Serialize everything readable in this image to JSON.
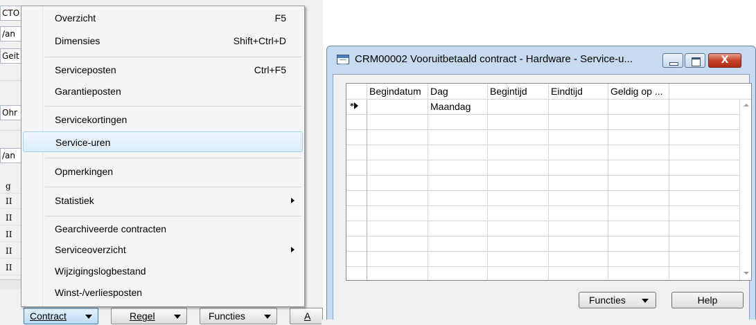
{
  "background": {
    "fields": [
      "CTO",
      "/an",
      "Geit",
      "Ohr",
      "/an",
      "g"
    ],
    "row_labels": [
      "II",
      "II",
      "II",
      "II",
      "II"
    ],
    "nav_buttons": [
      {
        "label": "Contract"
      },
      {
        "label": "Regel"
      },
      {
        "label": "Functies"
      },
      {
        "label": "A"
      }
    ]
  },
  "context_menu": {
    "items": [
      {
        "label": "Overzicht",
        "shortcut": "F5"
      },
      {
        "label": "Dimensies",
        "shortcut": "Shift+Ctrl+D"
      },
      {
        "label": "Serviceposten",
        "shortcut": "Ctrl+F5"
      },
      {
        "label": "Garantieposten",
        "shortcut": ""
      },
      {
        "label": "Servicekortingen",
        "shortcut": ""
      },
      {
        "label": "Service-uren",
        "shortcut": "",
        "highlighted": true
      },
      {
        "label": "Opmerkingen",
        "shortcut": ""
      },
      {
        "label": "Statistiek",
        "shortcut": "",
        "submenu": true
      },
      {
        "label": "Gearchiveerde contracten",
        "shortcut": ""
      },
      {
        "label": "Serviceoverzicht",
        "shortcut": "",
        "submenu": true
      },
      {
        "label": "Wijzigingslogbestand",
        "shortcut": ""
      },
      {
        "label": "Winst-/verliesposten",
        "shortcut": ""
      }
    ]
  },
  "dialog": {
    "title": "CRM00002 Vooruitbetaald contract - Hardware - Service-u...",
    "close_glyph": "X",
    "columns": [
      "Begindatum",
      "Dag",
      "Begintijd",
      "Eindtijd",
      "Geldig op ..."
    ],
    "rows": [
      {
        "marker": "*",
        "cells": [
          "",
          "Maandag",
          "",
          "",
          ""
        ]
      },
      {
        "marker": "",
        "cells": [
          "",
          "",
          "",
          "",
          ""
        ]
      },
      {
        "marker": "",
        "cells": [
          "",
          "",
          "",
          "",
          ""
        ]
      },
      {
        "marker": "",
        "cells": [
          "",
          "",
          "",
          "",
          ""
        ]
      },
      {
        "marker": "",
        "cells": [
          "",
          "",
          "",
          "",
          ""
        ]
      },
      {
        "marker": "",
        "cells": [
          "",
          "",
          "",
          "",
          ""
        ]
      },
      {
        "marker": "",
        "cells": [
          "",
          "",
          "",
          "",
          ""
        ]
      },
      {
        "marker": "",
        "cells": [
          "",
          "",
          "",
          "",
          ""
        ]
      },
      {
        "marker": "",
        "cells": [
          "",
          "",
          "",
          "",
          ""
        ]
      },
      {
        "marker": "",
        "cells": [
          "",
          "",
          "",
          "",
          ""
        ]
      },
      {
        "marker": "",
        "cells": [
          "",
          "",
          "",
          "",
          ""
        ]
      },
      {
        "marker": "",
        "cells": [
          "",
          "",
          "",
          "",
          ""
        ]
      }
    ],
    "buttons": {
      "functies": "Functies",
      "help": "Help"
    }
  },
  "colors": {
    "highlight": "#dbecfa",
    "title_bar": "#c7dbf0",
    "close_button": "#c3432b"
  }
}
